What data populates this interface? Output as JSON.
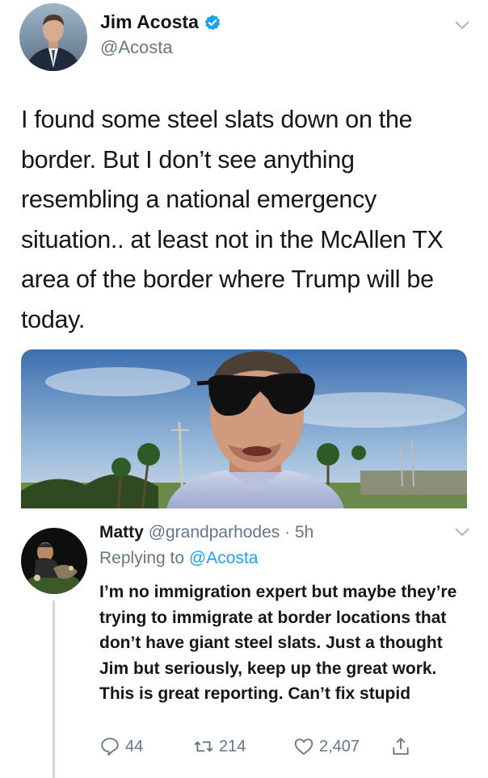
{
  "tweet": {
    "name": "Jim Acosta",
    "handle": "@Acosta",
    "text": "I found some steel slats down on the border. But I don’t see anything resembling a national emergency situation.. at least not in the McAllen TX area of the border where Trump will be today."
  },
  "reply": {
    "name": "Matty",
    "handle": "@grandparhodes",
    "separator": "·",
    "time": "5h",
    "replying_prefix": "Replying to",
    "replying_to": "@Acosta",
    "text": "I’m no immigration expert but maybe they’re trying to immigrate at border locations that don’t have giant steel slats. Just a thought Jim but seriously, keep up the great work. This is great reporting. Can’t fix stupid",
    "actions": {
      "replies": "44",
      "retweets": "214",
      "likes": "2,407"
    }
  },
  "colors": {
    "verified": "#1da1f2",
    "link": "#1da1f2",
    "meta": "#657786"
  },
  "icons": [
    "verified-badge-icon",
    "chevron-down-icon",
    "reply-icon",
    "retweet-icon",
    "like-icon",
    "share-icon"
  ]
}
